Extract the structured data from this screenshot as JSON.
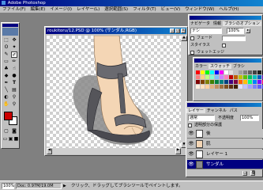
{
  "app": {
    "title": "Adobe Photoshop"
  },
  "menubar": {
    "items": [
      "ファイル(F)",
      "編集(E)",
      "イメージ(I)",
      "レイヤー(L)",
      "選択範囲(S)",
      "フィルタ(T)",
      "ビュー(V)",
      "ウィンドウ(W)",
      "ヘルプ(H)"
    ]
  },
  "document": {
    "title": "roukitoru/12.PSD @ 100% (サンダル,RGB)"
  },
  "options_panel": {
    "tabs": [
      "ナビゲータ",
      "情報",
      "ブラシのオプション"
    ],
    "rows": [
      "ナシ",
      "フェード",
      "スタイラス",
      "ウェットエッジ"
    ],
    "value": "100%"
  },
  "swatches_panel": {
    "tabs": [
      "カラー",
      "スウォッチ",
      "ブラシ"
    ],
    "colors": [
      "#ff0000",
      "#ffff00",
      "#00ff00",
      "#00ffff",
      "#0000ff",
      "#ff00ff",
      "#ffffff",
      "#e0e0e0",
      "#c0c0c0",
      "#a0a0a0",
      "#808080",
      "#606060",
      "#404040",
      "#202020",
      "#000000",
      "#ff8080",
      "#ffd080",
      "#c0ff80",
      "#80ffd0",
      "#80c0ff",
      "#d080ff",
      "#ff80c0",
      "#c00000",
      "#c06000",
      "#c0c000",
      "#60c000",
      "#00c060",
      "#00c0c0",
      "#0060c0",
      "#6000c0",
      "#800000",
      "#804000",
      "#808000",
      "#408000",
      "#008040",
      "#008080",
      "#004080",
      "#400080",
      "#800040",
      "#ff6000",
      "#ffc000",
      "#00ff80",
      "#0080ff",
      "#8000ff",
      "#ff0080",
      "#fff0e0",
      "#ffe0c0",
      "#ffd0a0",
      "#e0b080",
      "#c09060",
      "#a07040",
      "#805020",
      "#603010",
      "#402000",
      "#e0e0ff",
      "#c0c0ff",
      "#a0a0ff",
      "#8080ff",
      "#6060ff",
      "#4040ff"
    ]
  },
  "layers_panel": {
    "tabs": [
      "レイヤー",
      "チャンネル",
      "パス"
    ],
    "mode": "通常",
    "opacity_label": "不透明度",
    "opacity": "100%",
    "preserve_label": "透明部分の保護",
    "layers": [
      {
        "name": "後"
      },
      {
        "name": "肌"
      },
      {
        "name": "レイヤー 1"
      },
      {
        "name": "サンダル",
        "selected": true
      }
    ]
  },
  "statusbar": {
    "zoom": "100%",
    "doc_size": "Doc: 0.97M/19.0M",
    "hint": "クリック、ドラッグしてブラシツールでペイントします。"
  },
  "colors": {
    "foreground": "#cc0000",
    "background": "#ffffff",
    "title_active": "#000080",
    "selection": "#000080"
  }
}
